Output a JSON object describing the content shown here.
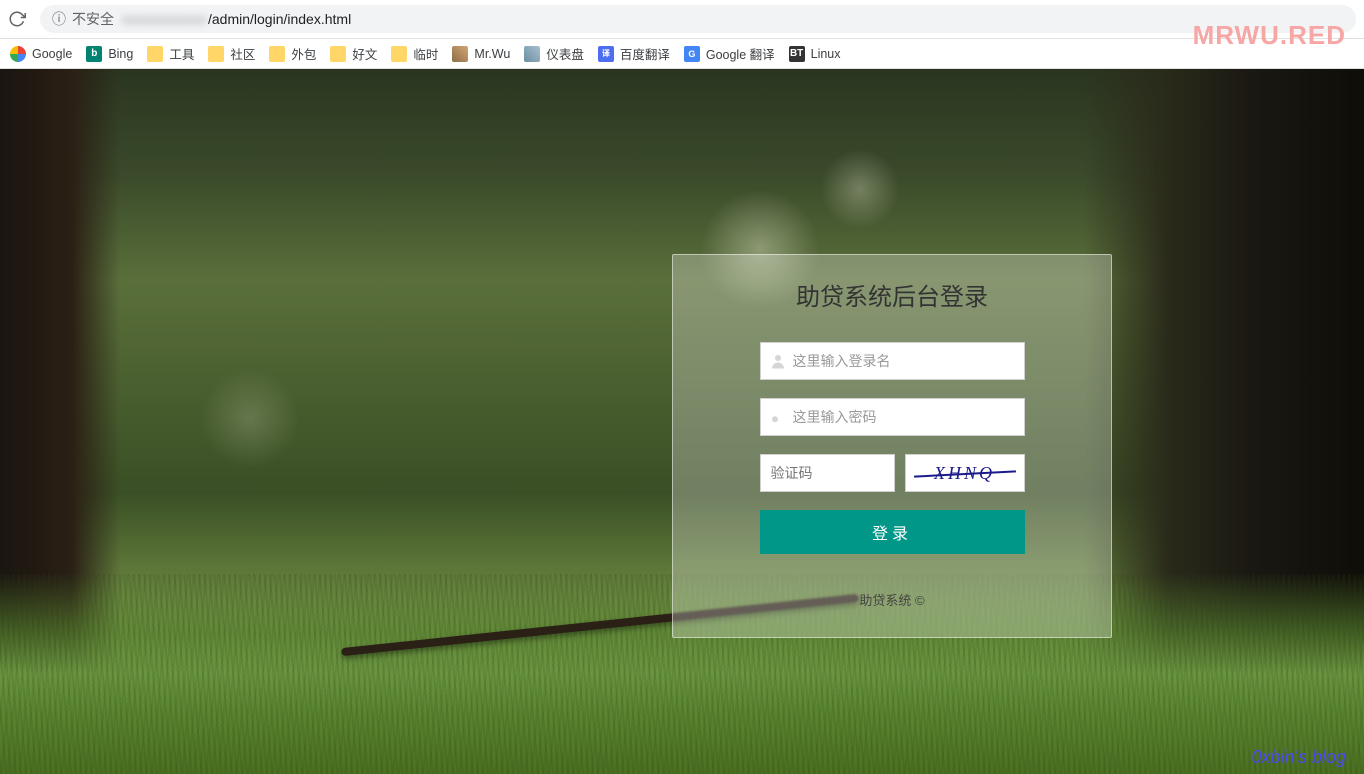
{
  "browser": {
    "insecure_label": "不安全",
    "url_path": "/admin/login/index.html"
  },
  "bookmarks": [
    {
      "icon": "google",
      "label": "Google"
    },
    {
      "icon": "bing",
      "label": "Bing"
    },
    {
      "icon": "folder",
      "label": "工具"
    },
    {
      "icon": "folder",
      "label": "社区"
    },
    {
      "icon": "folder",
      "label": "外包"
    },
    {
      "icon": "folder",
      "label": "好文"
    },
    {
      "icon": "folder",
      "label": "临时"
    },
    {
      "icon": "mrwu",
      "label": "Mr.Wu"
    },
    {
      "icon": "dash",
      "label": "仪表盘"
    },
    {
      "icon": "baidu",
      "label": "百度翻译"
    },
    {
      "icon": "gtrans",
      "label": "Google 翻译"
    },
    {
      "icon": "bt",
      "label": "Linux"
    }
  ],
  "watermarks": {
    "top": "MRWU.RED",
    "bottom": "0xbin's blog"
  },
  "login": {
    "title": "助贷系统后台登录",
    "username_placeholder": "这里输入登录名",
    "password_placeholder": "这里输入密码",
    "captcha_placeholder": "验证码",
    "captcha_text": "XHNQ",
    "button_label": "登录",
    "footer": "助贷系统 ©"
  },
  "colors": {
    "accent": "#009688"
  }
}
